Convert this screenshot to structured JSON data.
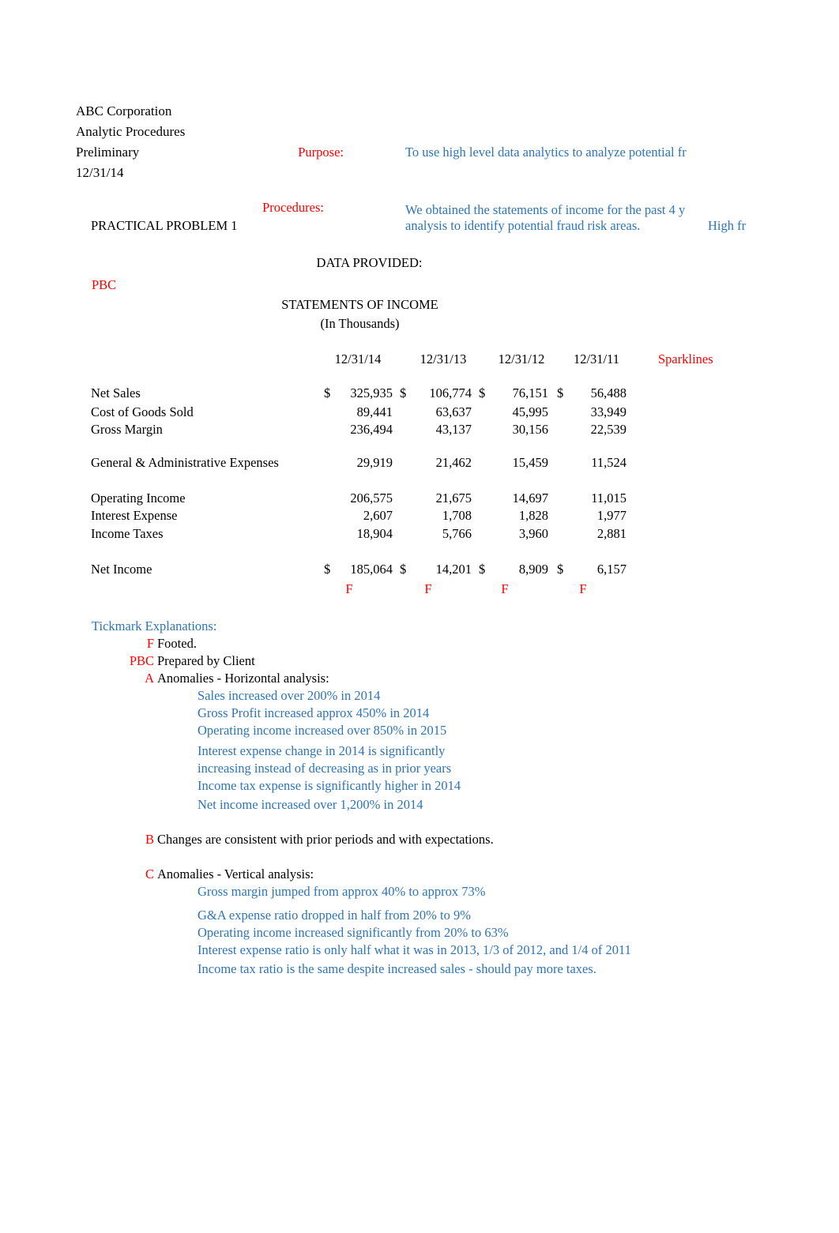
{
  "document": {
    "company": "ABC Corporation",
    "workpaper_type": "Analytic Procedures",
    "stage": "Preliminary",
    "period_end": "12/31/14",
    "problem_title": "PRACTICAL PROBLEM 1",
    "data_provided_heading": "DATA PROVIDED:",
    "pbc_marker": "PBC"
  },
  "purpose": {
    "label": "Purpose:",
    "text": "To use high level data analytics to analyze potential fr"
  },
  "procedures": {
    "label": "Procedures:",
    "line1": "We obtained the statements of income for the past 4 y",
    "line2": "analysis to identify potential fraud risk areas.",
    "line3": "High fr"
  },
  "statement": {
    "title": "STATEMENTS OF INCOME",
    "subtitle": "(In Thousands)",
    "sparklines_header": "Sparklines",
    "columns": [
      "12/31/14",
      "12/31/13",
      "12/31/12",
      "12/31/11"
    ],
    "currency_symbol": "$",
    "footed_tick": "F",
    "rows": [
      {
        "label": "Net Sales",
        "values": [
          "325,935",
          "106,774",
          "76,151",
          "56,488"
        ],
        "dollar": true,
        "tick": false
      },
      {
        "label": "Cost of Goods Sold",
        "values": [
          "89,441",
          "63,637",
          "45,995",
          "33,949"
        ],
        "dollar": false,
        "tick": false
      },
      {
        "label": "Gross Margin",
        "values": [
          "236,494",
          "43,137",
          "30,156",
          "22,539"
        ],
        "dollar": false,
        "tick": false
      },
      {
        "label": "General & Administrative Expenses",
        "values": [
          "29,919",
          "21,462",
          "15,459",
          "11,524"
        ],
        "dollar": false,
        "tick": false
      },
      {
        "label": "Operating Income",
        "values": [
          "206,575",
          "21,675",
          "14,697",
          "11,015"
        ],
        "dollar": false,
        "tick": false
      },
      {
        "label": "Interest Expense",
        "values": [
          "2,607",
          "1,708",
          "1,828",
          "1,977"
        ],
        "dollar": false,
        "tick": false
      },
      {
        "label": "Income Taxes",
        "values": [
          "18,904",
          "5,766",
          "3,960",
          "2,881"
        ],
        "dollar": false,
        "tick": false
      },
      {
        "label": "Net Income",
        "values": [
          "185,064",
          "14,201",
          "8,909",
          "6,157"
        ],
        "dollar": true,
        "tick": true
      }
    ]
  },
  "tickmarks": {
    "heading": "Tickmark Explanations:",
    "entries": [
      {
        "symbol": "F",
        "text": "Footed.",
        "sub": []
      },
      {
        "symbol": "PBC",
        "text": "Prepared by Client",
        "sub": []
      },
      {
        "symbol": "A",
        "text": "Anomalies - Horizontal analysis:",
        "sub": [
          "Sales increased over 200% in 2014",
          "Gross Profit increased approx 450% in 2014",
          "Operating income increased over 850% in 2015",
          "Interest expense change in 2014 is significantly",
          "increasing instead of decreasing as in prior years",
          "Income tax expense is significantly higher in 2014",
          "Net income increased over 1,200% in 2014"
        ]
      },
      {
        "symbol": "B",
        "text": "Changes are consistent with prior periods and with expectations.",
        "sub": []
      },
      {
        "symbol": "C",
        "text": "Anomalies - Vertical analysis:",
        "sub": [
          "Gross margin jumped from approx 40% to approx 73%",
          "G&A expense ratio dropped in half from 20% to 9%",
          "Operating income increased significantly from 20% to 63%",
          "Interest expense ratio is only half what it was in 2013, 1/3 of 2012, and 1/4 of 2011",
          "Income tax ratio is the same despite increased sales - should pay more taxes."
        ]
      }
    ]
  },
  "colors": {
    "red": "#FF0000",
    "blue": "#2E75B6",
    "black": "#000000",
    "background": "#FFFFFF"
  }
}
